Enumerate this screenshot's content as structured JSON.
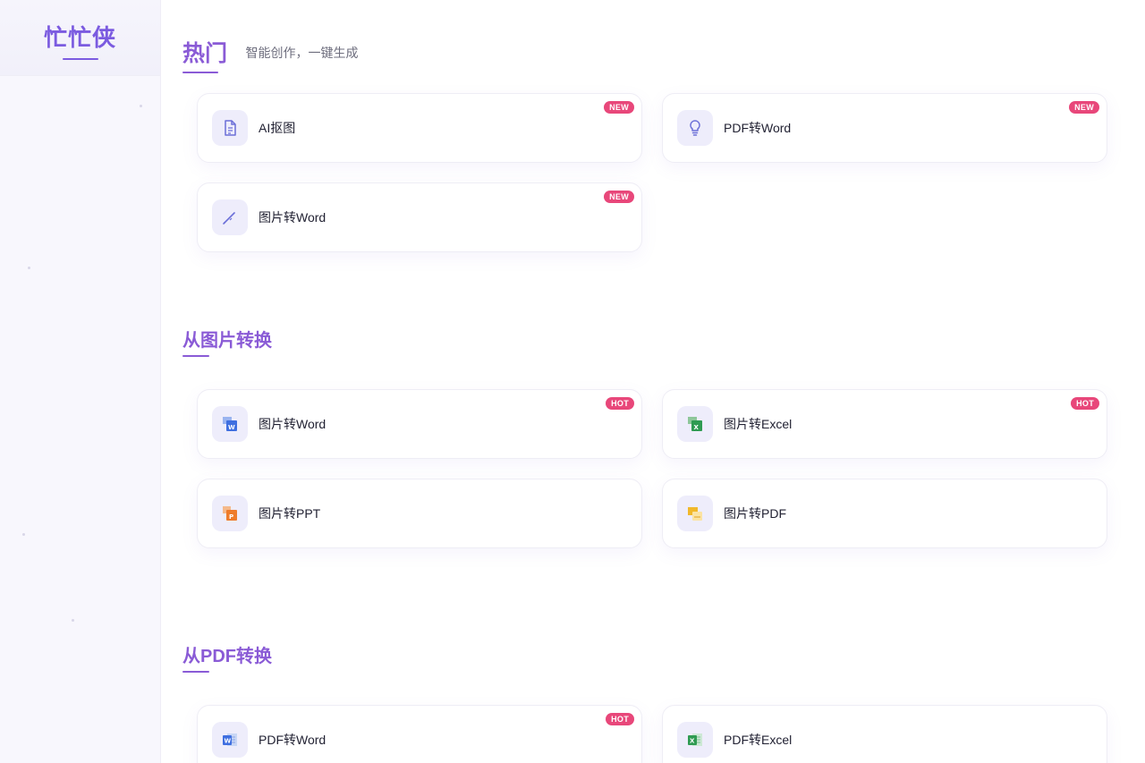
{
  "sidebar": {
    "brand": "忙忙侠"
  },
  "sections": [
    {
      "title": "热门",
      "subtitle": "智能创作，一键生成",
      "cards": [
        {
          "label": "AI抠图",
          "badge": "NEW",
          "icon": "document-icon"
        },
        {
          "label": "PDF转Word",
          "badge": "NEW",
          "icon": "lightbulb-icon"
        },
        {
          "label": "图片转Word",
          "badge": "NEW",
          "icon": "pen-icon"
        }
      ]
    },
    {
      "title": "从图片转换",
      "cards": [
        {
          "label": "图片转Word",
          "badge": "HOT",
          "icon": "image-word-icon"
        },
        {
          "label": "图片转Excel",
          "badge": "HOT",
          "icon": "image-excel-icon"
        },
        {
          "label": "图片转PPT",
          "icon": "image-ppt-icon"
        },
        {
          "label": "图片转PDF",
          "icon": "image-pdf-icon"
        }
      ]
    },
    {
      "title": "从PDF转换",
      "cards": [
        {
          "label": "PDF转Word",
          "badge": "HOT",
          "icon": "word-file-icon"
        },
        {
          "label": "PDF转Excel",
          "icon": "excel-file-icon"
        }
      ]
    }
  ],
  "colors": {
    "accent": "#8a5bd6",
    "badge": "#e8477a",
    "icon_bg": "#eeedfb"
  }
}
